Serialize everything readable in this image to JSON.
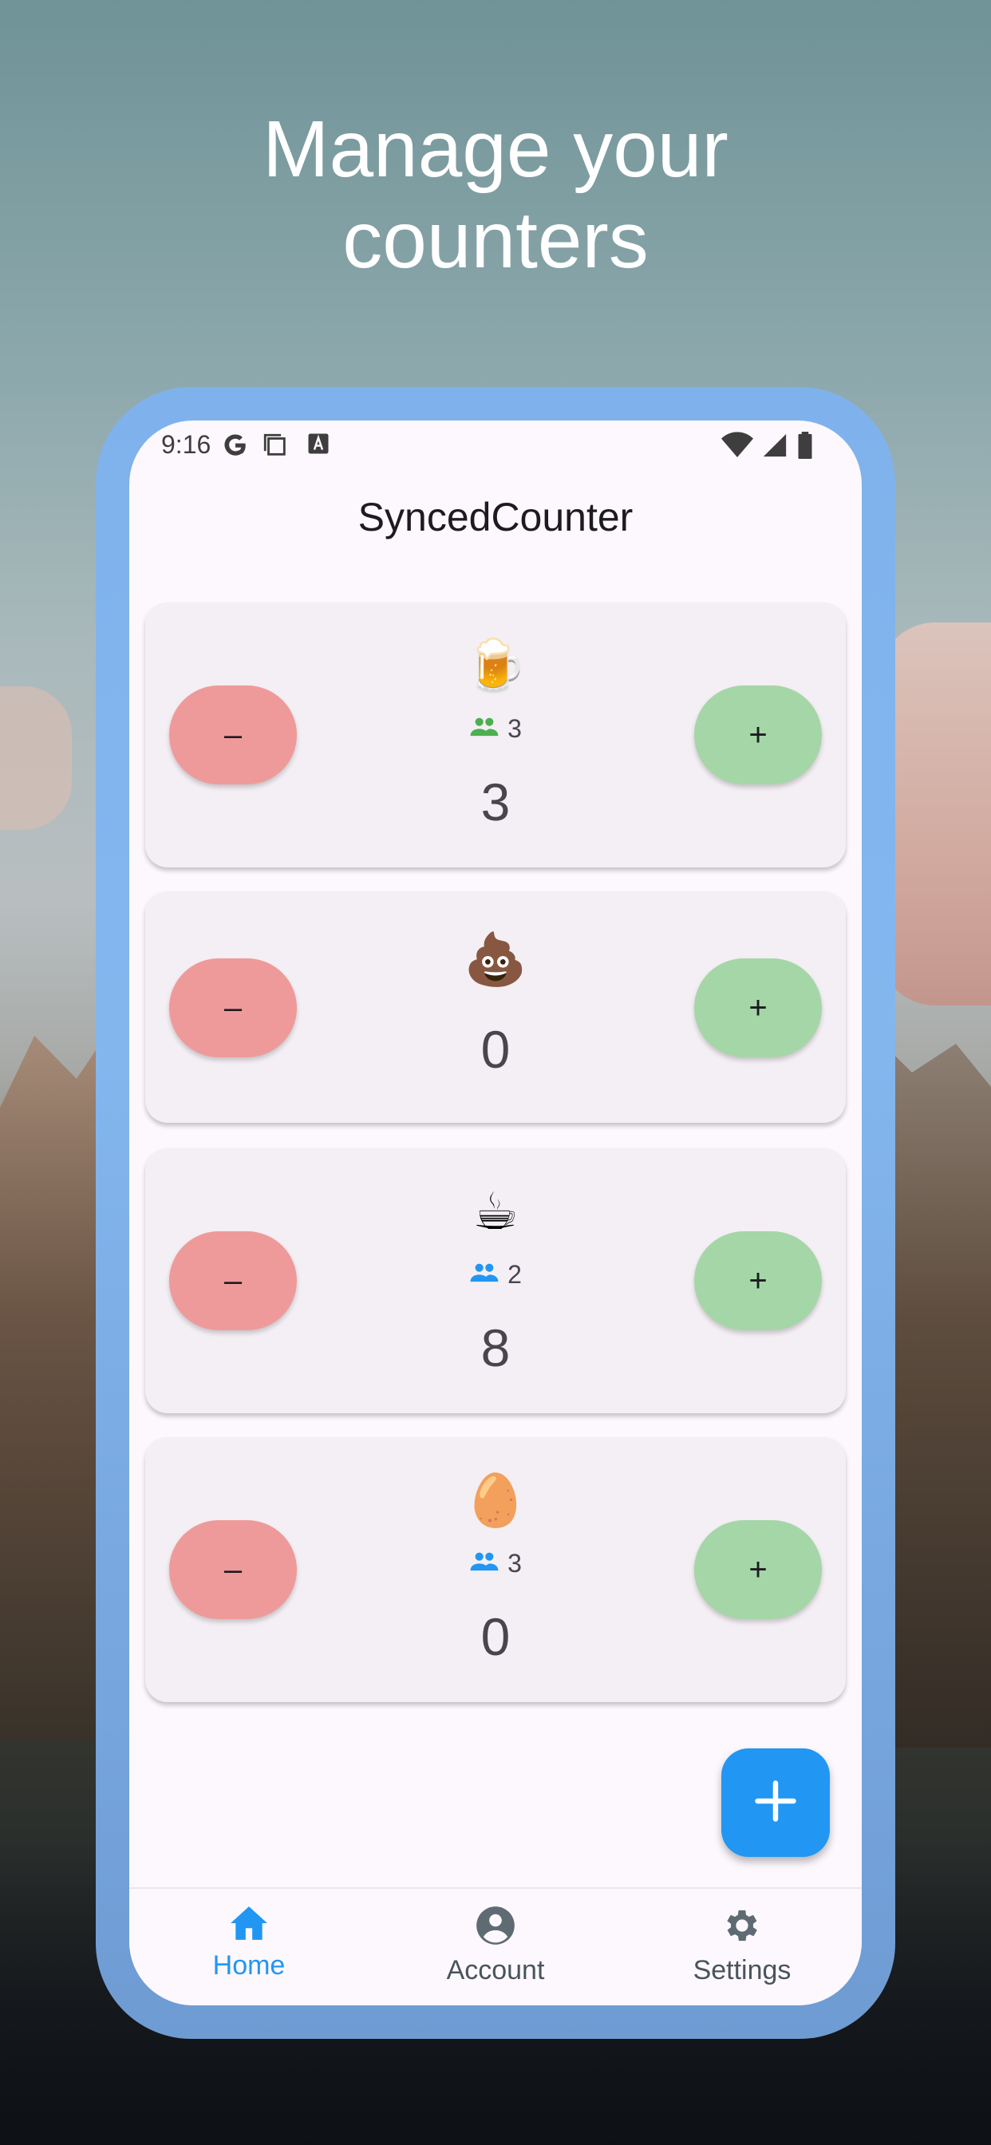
{
  "headline": [
    "Manage your",
    "counters"
  ],
  "status_bar": {
    "time": "9:16"
  },
  "app_bar": {
    "title": "SyncedCounter"
  },
  "counters": [
    {
      "emoji": "🍺",
      "value": "3",
      "shared_with": "3",
      "shared_color": "#4caf50"
    },
    {
      "emoji": "💩",
      "value": "0",
      "shared_with": null
    },
    {
      "emoji": "☕",
      "value": "8",
      "shared_with": "2",
      "shared_color": "#2196f3"
    },
    {
      "emoji": "🥚",
      "value": "0",
      "shared_with": "3",
      "shared_color": "#2196f3"
    }
  ],
  "buttons": {
    "decrement": "–",
    "increment": "+"
  },
  "bottom_nav": [
    {
      "label": "Home",
      "icon": "home-icon",
      "active": true
    },
    {
      "label": "Account",
      "icon": "account-icon",
      "active": false
    },
    {
      "label": "Settings",
      "icon": "settings-icon",
      "active": false
    }
  ],
  "colors": {
    "accent": "#2196f3",
    "decrement": "#ef9a9a",
    "increment": "#a5d6a7",
    "card": "#f4eff4",
    "frame": "#7fb2ec"
  }
}
